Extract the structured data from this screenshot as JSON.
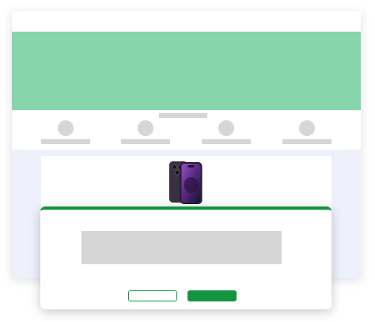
{
  "colors": {
    "hero": "#86d5ab",
    "placeholder": "#d6d6d6",
    "lower_background": "#eef1fb",
    "accent": "#12953f"
  },
  "feature_row": {
    "items": [
      {
        "icon": "circle-placeholder-icon"
      },
      {
        "icon": "circle-placeholder-icon"
      },
      {
        "icon": "circle-placeholder-icon"
      },
      {
        "icon": "circle-placeholder-icon"
      }
    ]
  },
  "product": {
    "image": "smartphone-icon"
  },
  "modal": {
    "cancel_label": "",
    "confirm_label": ""
  }
}
